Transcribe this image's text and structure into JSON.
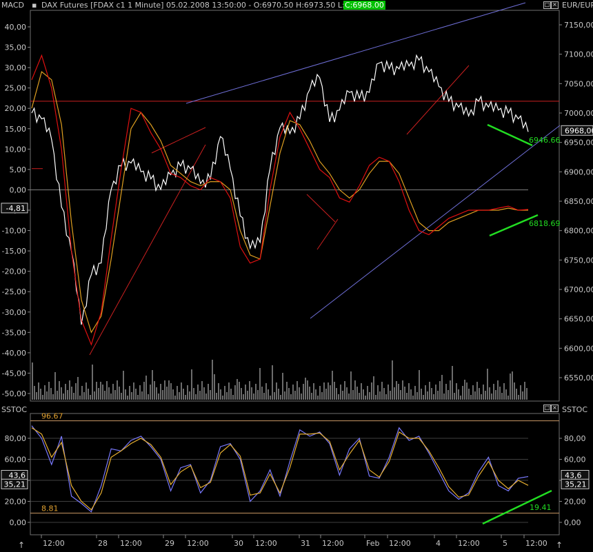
{
  "header": {
    "indicator_name": "MACD",
    "title": "DAX Futures [FDAX c1  1 Minute] 05.02.2008 13:50:00 - O:6970.50 H:6973.50 L:6968.00",
    "close_label": "C:6968.00",
    "currency": "EUR/EUR",
    "lower_panel_name": "SSTOC",
    "lower_panel_name_right": "SSTOC",
    "button_min": "□",
    "button_close": "×"
  },
  "colors": {
    "background": "#000000",
    "price": "#ffffff",
    "macd_red": "#e01010",
    "macd_orange": "#e0a020",
    "trendline_red": "#cc2020",
    "trendline_blue": "#6f6fd8",
    "divergence_green": "#22dd22",
    "stoch_blue": "#7a7aff",
    "stoch_orange": "#e8b030",
    "level_line": "#cc9966",
    "grid": "#808080",
    "close_badge": "#00c000"
  },
  "chart_data": [
    {
      "type": "line",
      "panel": "upper",
      "title": "DAX Futures [FDAX c1  1 Minute]",
      "ylabel_left": "MACD",
      "ylabel_right": "EUR/EUR",
      "left_axis": {
        "ticks": [
          "40,00",
          "35,00",
          "30,00",
          "25,00",
          "20,00",
          "15,00",
          "10,00",
          "5,00",
          "0,00",
          "-5,00",
          "-10,00",
          "-15,00",
          "-20,00",
          "-25,00",
          "-30,00",
          "-35,00",
          "-40,00",
          "-45,00",
          "-50,00"
        ],
        "range": [
          -52,
          42
        ],
        "current_badge": "-4,81",
        "current_value": -4.81
      },
      "right_axis": {
        "ticks": [
          "7150,00",
          "7100,00",
          "7050,00",
          "7000,00",
          "6950,00",
          "6900,00",
          "6850,00",
          "6800,00",
          "6750,00",
          "6700,00",
          "6650,00",
          "6600,00",
          "6550,00"
        ],
        "range": [
          6545,
          7168
        ],
        "current_badge": "6968,00",
        "current_value": 6968.0
      },
      "x_labels": [
        "12:00",
        "28",
        "12:00",
        "29",
        "12:00",
        "30",
        "12:00",
        "31",
        "12:00",
        "Feb",
        "12:00",
        "4",
        "12:00",
        "5",
        "12:00"
      ],
      "price_series": {
        "name": "FDAX close",
        "x": [
          0,
          2,
          4,
          6,
          8,
          10,
          12,
          14,
          16,
          18,
          20,
          22,
          24,
          26,
          28,
          30,
          32,
          34,
          36,
          38,
          40,
          42,
          44,
          46,
          48,
          50,
          52,
          54,
          56,
          58,
          60,
          62,
          64,
          66,
          68,
          70,
          72,
          74,
          76,
          78,
          80,
          82,
          84,
          86,
          88,
          90,
          92,
          94,
          96,
          98,
          100
        ],
        "y": [
          7000,
          6990,
          6955,
          6840,
          6765,
          6640,
          6725,
          6745,
          6870,
          6910,
          6915,
          6900,
          6888,
          6870,
          6895,
          6910,
          6905,
          6880,
          6888,
          6960,
          6905,
          6825,
          6770,
          6780,
          6905,
          6975,
          6965,
          6990,
          7040,
          7060,
          6985,
          7005,
          7035,
          7025,
          7035,
          7085,
          7075,
          7075,
          7080,
          7090,
          7070,
          7045,
          7020,
          7010,
          6995,
          7020,
          7010,
          7005,
          7000,
          6990,
          6968
        ]
      },
      "macd_series": [
        {
          "name": "MACD",
          "x": [
            0,
            2,
            4,
            6,
            8,
            10,
            12,
            14,
            16,
            18,
            20,
            22,
            24,
            26,
            28,
            30,
            32,
            34,
            36,
            38,
            40,
            42,
            44,
            46,
            48,
            50,
            52,
            54,
            56,
            58,
            60,
            62,
            64,
            66,
            68,
            70,
            72,
            74,
            76,
            78,
            80,
            82,
            84,
            86,
            88,
            90,
            92,
            94,
            96,
            98,
            100
          ],
          "y": [
            27,
            33,
            25,
            10,
            -15,
            -32,
            -38,
            -30,
            -12,
            5,
            20,
            19,
            14,
            10,
            4,
            3,
            1,
            0,
            3,
            2,
            -2,
            -14,
            -18,
            -17,
            0,
            13,
            19,
            15,
            10,
            5,
            3,
            -2,
            -3,
            1,
            6,
            8,
            7,
            2,
            -5,
            -10,
            -11,
            -9,
            -7,
            -6,
            -5,
            -5,
            -5,
            -4.5,
            -4,
            -5,
            -4.81
          ]
        },
        {
          "name": "Signal",
          "x": [
            0,
            2,
            4,
            6,
            8,
            10,
            12,
            14,
            16,
            18,
            20,
            22,
            24,
            26,
            28,
            30,
            32,
            34,
            36,
            38,
            40,
            42,
            44,
            46,
            48,
            50,
            52,
            54,
            56,
            58,
            60,
            62,
            64,
            66,
            68,
            70,
            72,
            74,
            76,
            78,
            80,
            82,
            84,
            86,
            88,
            90,
            92,
            94,
            96,
            98,
            100
          ],
          "y": [
            20,
            29,
            27,
            16,
            -8,
            -27,
            -35,
            -31,
            -17,
            -1,
            15,
            19,
            16,
            12,
            6,
            4,
            2,
            1,
            2,
            2,
            0,
            -10,
            -16,
            -17,
            -4,
            9,
            17,
            16,
            12,
            7,
            4,
            0,
            -2,
            0,
            4,
            7,
            7,
            4,
            -2,
            -8,
            -10,
            -10,
            -8,
            -7,
            -6,
            -5,
            -5,
            -5,
            -4.5,
            -5,
            -5
          ]
        }
      ],
      "annotations": [
        {
          "text": "6946.66",
          "color": "#22dd22"
        },
        {
          "text": "6818.69",
          "color": "#22dd22"
        }
      ],
      "grid": "horizontal lines at 0,00 and ~7020"
    },
    {
      "type": "line",
      "panel": "lower",
      "title": "SSTOC",
      "left_axis": {
        "ticks": [
          "80,00",
          "60,00",
          "40,00",
          "20,00",
          "0,00"
        ],
        "range": [
          -7,
          101
        ],
        "badges": [
          "43,6",
          "35,21"
        ],
        "badge_values": [
          43.6,
          35.21
        ]
      },
      "right_axis": {
        "ticks": [
          "80,00",
          "60,00",
          "40,00",
          "20,00",
          "0,00"
        ],
        "badges": [
          "43,6",
          "35,21"
        ],
        "badge_values": [
          43.6,
          35.21
        ]
      },
      "levels": [
        {
          "text": "96.67",
          "value": 96.67
        },
        {
          "text": "8.81",
          "value": 8.81
        }
      ],
      "series": [
        {
          "name": "%K",
          "x": [
            0,
            2,
            4,
            6,
            8,
            10,
            12,
            14,
            16,
            18,
            20,
            22,
            24,
            26,
            28,
            30,
            32,
            34,
            36,
            38,
            40,
            42,
            44,
            46,
            48,
            50,
            52,
            54,
            56,
            58,
            60,
            62,
            64,
            66,
            68,
            70,
            72,
            74,
            76,
            78,
            80,
            82,
            84,
            86,
            88,
            90,
            92,
            94,
            96,
            98,
            100
          ],
          "y": [
            92,
            80,
            55,
            82,
            25,
            18,
            10,
            35,
            70,
            68,
            78,
            82,
            72,
            60,
            30,
            52,
            55,
            28,
            40,
            72,
            75,
            60,
            20,
            30,
            50,
            25,
            58,
            88,
            82,
            86,
            75,
            45,
            70,
            80,
            44,
            42,
            62,
            90,
            78,
            82,
            66,
            48,
            30,
            22,
            28,
            48,
            62,
            35,
            30,
            42,
            43.6
          ]
        },
        {
          "name": "%D",
          "x": [
            0,
            2,
            4,
            6,
            8,
            10,
            12,
            14,
            16,
            18,
            20,
            22,
            24,
            26,
            28,
            30,
            32,
            34,
            36,
            38,
            40,
            42,
            44,
            46,
            48,
            50,
            52,
            54,
            56,
            58,
            60,
            62,
            64,
            66,
            68,
            70,
            72,
            74,
            76,
            78,
            80,
            82,
            84,
            86,
            88,
            90,
            92,
            94,
            96,
            98,
            100
          ],
          "y": [
            90,
            84,
            62,
            76,
            35,
            20,
            12,
            28,
            62,
            68,
            75,
            80,
            74,
            62,
            36,
            48,
            54,
            33,
            38,
            66,
            74,
            63,
            26,
            28,
            46,
            28,
            52,
            84,
            84,
            85,
            77,
            50,
            65,
            78,
            50,
            43,
            58,
            86,
            80,
            80,
            68,
            52,
            34,
            24,
            26,
            44,
            58,
            40,
            32,
            40,
            35.21
          ]
        }
      ],
      "annotations": [
        {
          "text": "19.41",
          "color": "#22dd22"
        }
      ]
    }
  ]
}
